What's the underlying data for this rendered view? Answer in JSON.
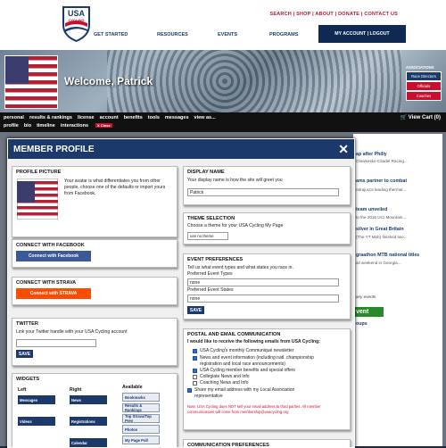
{
  "header": {
    "logo_text": "USA CYCLING",
    "utility_links": "SEARCH | SHOP | ABOUT | DONATE | CONTACT US",
    "nav": [
      "GET STARTED",
      "RESOURCES",
      "EVENTS",
      "PROGRAMS"
    ],
    "account": "MY ACCOUNT | LOGOUT"
  },
  "banner": {
    "welcome": "Welcome, Patrick",
    "associations_label": "ASSOCIATIONS",
    "assoc_buttons": [
      "Race Directors",
      "Officials",
      "Coaches"
    ]
  },
  "subnav": {
    "row1": [
      "personal",
      "results & rankings",
      "license",
      "account",
      "benefits",
      "tools",
      "messages",
      "view as..."
    ],
    "row2": [
      "profile",
      "bio",
      "timeline",
      "interactions"
    ],
    "close_label": "X Close",
    "cart": "View Cart (0)"
  },
  "right_col": {
    "items": [
      {
        "title": "ap after Philly",
        "sub": "Olowkesko-Citadel Racing..."
      },
      {
        "title": "ams partner to combat",
        "sub": "ndrajuccs leading thermal..."
      },
      {
        "title": "team unveiled",
        "sub": "to the 2016 UCI Mountain..."
      },
      {
        "title": "silver in Great Britain",
        "sub": "(The YT Mob) finished two..."
      },
      {
        "title": "graathon MTB national titles",
        "sub": "ail weekend in Georgia..."
      }
    ],
    "events_text": "any events.",
    "green_button": "vent",
    "groups": "oups"
  },
  "modal": {
    "title": "MEMBER PROFILE",
    "close_icon": "close-icon",
    "profile_picture": {
      "title": "PROFILE PICTURE",
      "text": "Your avatar is what differentiates you from other people, choose one of the defaults or import yours from Facebook."
    },
    "facebook": {
      "title": "CONNECT WITH FACEBOOK",
      "button": "Connect with Facebook"
    },
    "strava": {
      "title": "CONNECT WITH STRAVA",
      "button": "Connect with STRAVA"
    },
    "twitter": {
      "title": "TWITTER",
      "text": "Link your Twitter handle with your USA Cycling account",
      "value": "",
      "save": "SAVE"
    },
    "widgets": {
      "title": "WIDGETS",
      "left_label": "Left",
      "right_label": "Right",
      "available_label": "Available",
      "left": [
        "Messages",
        "Videos"
      ],
      "right": [
        "News",
        "Registrations",
        "Calendar"
      ],
      "available": [
        "Bookmarks",
        "Results & Rankings",
        "Top Strava/Top Prev",
        "Photos",
        "My Page Poll"
      ]
    },
    "display_name": {
      "title": "DISPLAY NAME",
      "text": "Your display name is how the site will greet you",
      "value": "Patrick"
    },
    "theme": {
      "title": "THEME SELECTION",
      "text": "Choose a theme for your USA Cycling My Page",
      "value": "use no theme"
    },
    "event_prefs": {
      "title": "EVENT PREFERENCES",
      "text": "Tell us what event types and what states you race in.",
      "types_label": "Preferred Event Types",
      "types_value": "none",
      "states_label": "Preferred Event States",
      "states_value": "none",
      "save": "SAVE"
    },
    "postal": {
      "title": "POSTAL AND EMAIL COMMUNICATION",
      "subtitle": "I would like to receive the following emails from USA Cycling:",
      "options": [
        {
          "label": "USA Cycling's monthly Communiqué newsletter",
          "checked": true
        },
        {
          "label": "News and event information (including natl. championship",
          "checked": true
        },
        {
          "label": "registration and local race announcements)",
          "checked": null
        },
        {
          "label": "USA Cycling member benefits and special offers",
          "checked": true
        },
        {
          "label": "Collegiate News and Info",
          "checked": false
        },
        {
          "label": "Coaching News and Info",
          "checked": false
        },
        {
          "label": "Share my email address with my Local Association",
          "checked": true
        },
        {
          "label": "representative",
          "checked": null
        }
      ],
      "note": "Note: USA Cycling does NOT sell your email address to third parties. All member communications will come from membership@usacycling.org"
    },
    "comm_prefs": {
      "title": "COMMUNICATION PREFERENCES"
    }
  }
}
